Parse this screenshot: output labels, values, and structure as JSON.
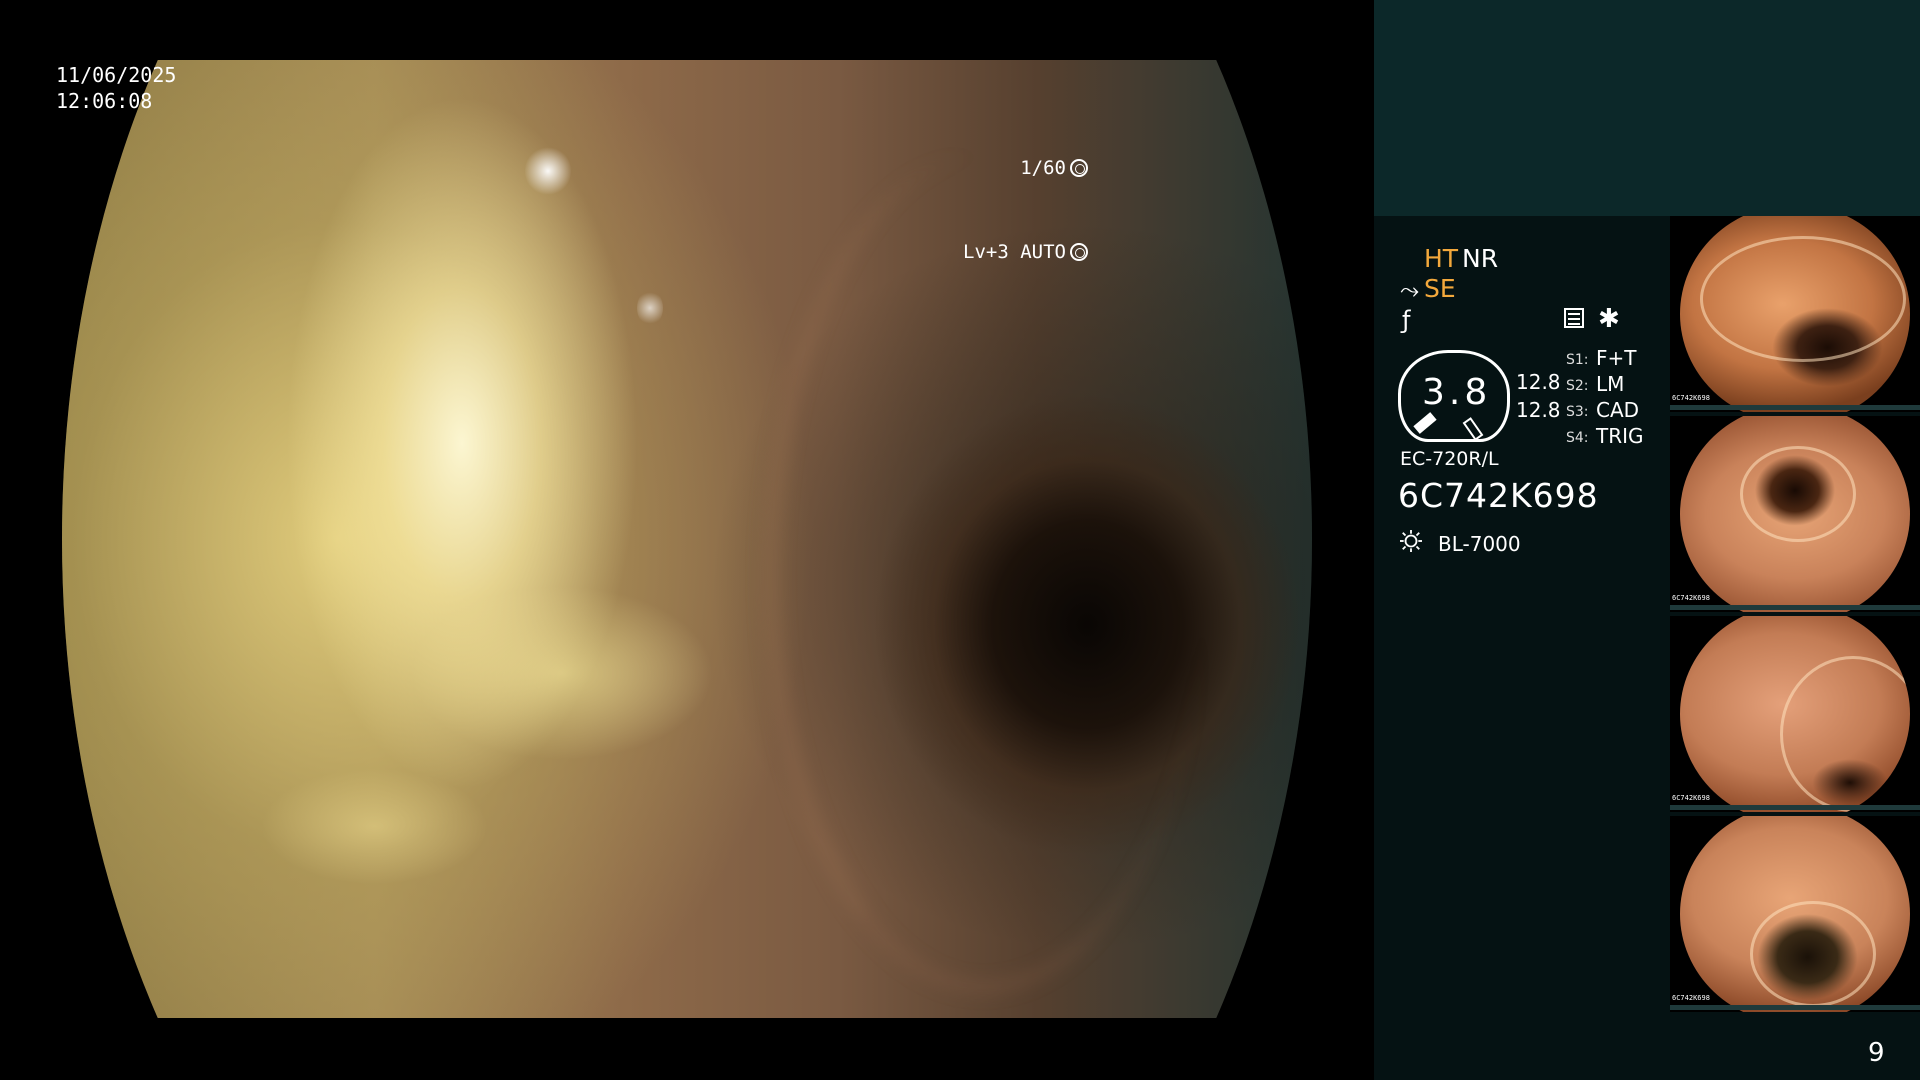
{
  "overlay": {
    "date": "11/06/2025",
    "time": "12:06:08",
    "shutter": "1/60",
    "level": "Lv+3 AUTO"
  },
  "panel": {
    "ht": "HT",
    "nr": "NR",
    "se": "SE",
    "gauge_value": "3.8",
    "value_1": "12.8",
    "value_2": "12.8",
    "switches": [
      {
        "label": "S1:",
        "value": "F+T"
      },
      {
        "label": "S2:",
        "value": "LM"
      },
      {
        "label": "S3:",
        "value": "CAD"
      },
      {
        "label": "S4:",
        "value": "TRIG"
      }
    ],
    "scope_model": "EC-720R/L",
    "scope_serial": "6C742K698",
    "light_source": "BL-7000",
    "thumbnail_serial": "6C742K698",
    "page_number": "9"
  },
  "icons": {
    "shutter": "shutter-icon",
    "auto": "auto-iris-icon",
    "enhance": "enhance-icon",
    "f": "f-icon",
    "menu": "menu-icon",
    "star": "star-icon",
    "light": "light-bulb-icon"
  },
  "colors": {
    "accent": "#f3a83c",
    "panel_top": "#0c2829",
    "panel_body": "#051213"
  }
}
